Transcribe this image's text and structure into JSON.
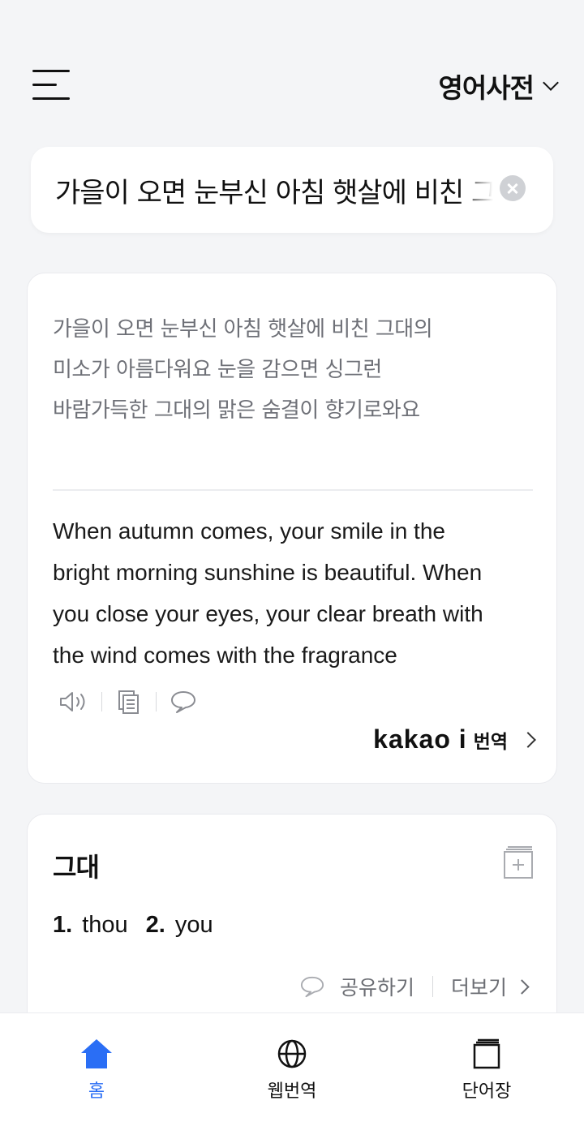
{
  "header": {
    "dict_label": "영어사전"
  },
  "search": {
    "value": "가을이 오면 눈부신 아침 햇살에 비친 그대의 미소가 아름다워요"
  },
  "translation": {
    "source_lines": [
      "가을이 오면 눈부신 아침 햇살에 비친 그대의",
      "미소가 아름다워요 눈을 감으면 싱그런",
      "바람가득한 그대의 맑은 숨결이 향기로와요"
    ],
    "target_lines": [
      "When autumn comes, your smile in the",
      "bright morning sunshine is beautiful. When",
      "you close your eyes, your clear breath with",
      "the wind comes with the fragrance"
    ],
    "brand": "kakao i",
    "brand_suffix": "번역"
  },
  "word": {
    "title": "그대",
    "meanings": [
      {
        "num": "1.",
        "text": "thou"
      },
      {
        "num": "2.",
        "text": "you"
      }
    ],
    "share_label": "공유하기",
    "more_label": "더보기"
  },
  "nav": {
    "items": [
      {
        "label": "홈",
        "icon": "home-icon",
        "active": true
      },
      {
        "label": "웹번역",
        "icon": "globe-icon",
        "active": false
      },
      {
        "label": "단어장",
        "icon": "wordbook-icon",
        "active": false
      }
    ],
    "active_color": "#2a6ef5"
  }
}
